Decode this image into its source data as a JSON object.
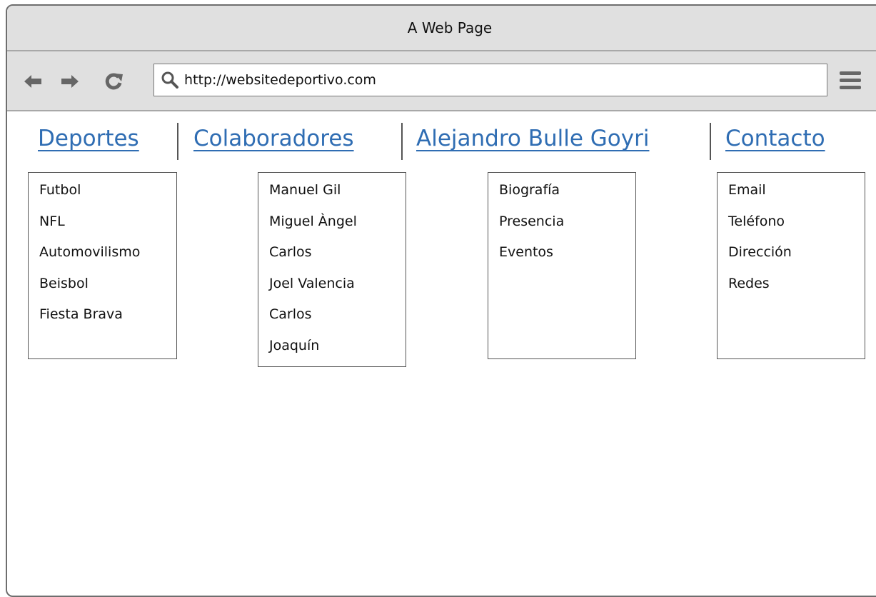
{
  "window": {
    "title": "A Web Page"
  },
  "toolbar": {
    "url": "http://websitedeportivo.com",
    "back_icon": "arrow-left-icon",
    "forward_icon": "arrow-right-icon",
    "reload_icon": "reload-icon",
    "search_icon": "search-icon",
    "menu_icon": "hamburger-menu-icon"
  },
  "nav": {
    "items": [
      {
        "label": "Deportes",
        "submenu": [
          "Futbol",
          "NFL",
          "Automovilismo",
          "Beisbol",
          "Fiesta Brava"
        ]
      },
      {
        "label": "Colaboradores",
        "submenu": [
          "Manuel Gil",
          "Miguel Àngel",
          "Carlos",
          "Joel Valencia",
          "Carlos",
          "Joaquín"
        ]
      },
      {
        "label": "Alejandro Bulle Goyri",
        "submenu": [
          "Biografía",
          "Presencia",
          "Eventos"
        ]
      },
      {
        "label": "Contacto",
        "submenu": [
          "Email",
          "Teléfono",
          "Dirección",
          "Redes"
        ]
      }
    ]
  },
  "colors": {
    "link": "#2f6db3",
    "chrome": "#e0e0e0",
    "border": "#555555"
  }
}
